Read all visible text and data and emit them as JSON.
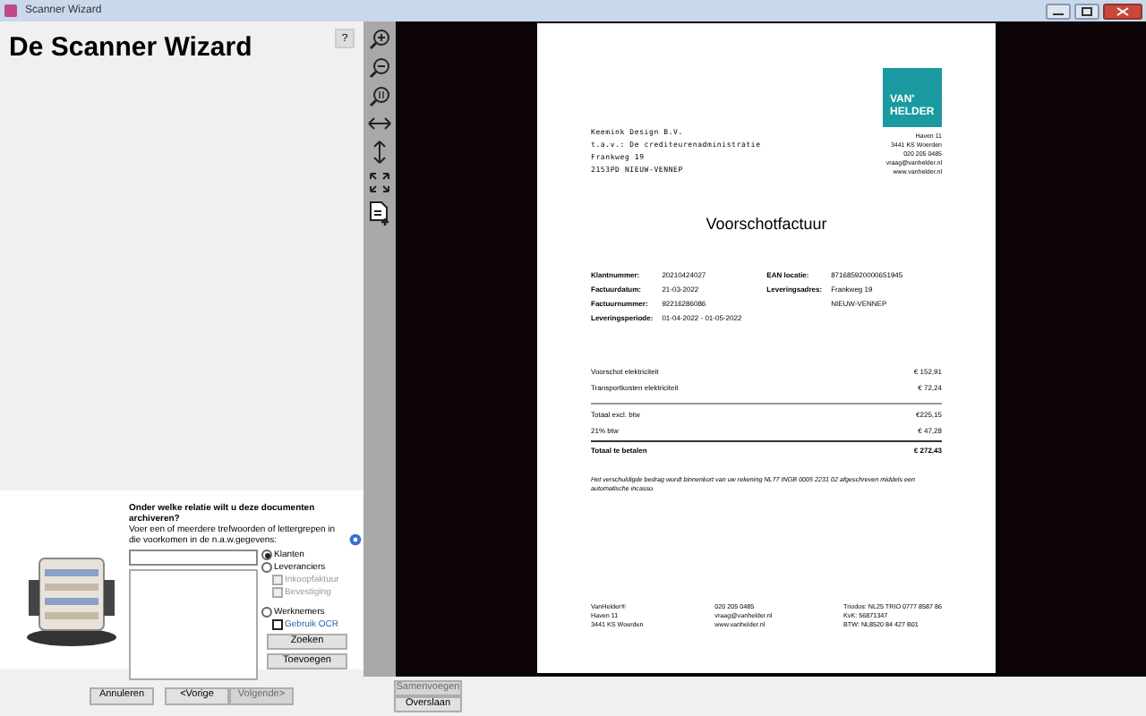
{
  "window": {
    "title": "Scanner Wizard"
  },
  "wizard": {
    "heading": "De Scanner Wizard",
    "help_button": "?"
  },
  "relation": {
    "question": "Onder welke relatie wilt u deze documenten archiveren?",
    "hint": "Voer een of meerdere trefwoorden of lettergrepen in die voorkomen in de n.a.w.gegevens:",
    "options": [
      {
        "kind": "radio",
        "label": "Klanten",
        "selected": true,
        "disabled": false
      },
      {
        "kind": "radio",
        "label": "Leveranciers",
        "selected": false,
        "disabled": false
      },
      {
        "kind": "checkbox",
        "label": "Inkoopfaktuur",
        "checked": false,
        "disabled": true
      },
      {
        "kind": "checkbox",
        "label": "Bevestiging",
        "checked": false,
        "disabled": true
      },
      {
        "kind": "radio",
        "label": "Werknemers",
        "selected": false,
        "disabled": false
      },
      {
        "kind": "checkbox",
        "label": "Gebruik OCR",
        "checked": false,
        "disabled": false
      }
    ],
    "buttons": [
      "Zoeken",
      "Toevoegen"
    ]
  },
  "nav_buttons": [
    {
      "label": "Annuleren",
      "disabled": false
    },
    {
      "label": "<Vorige",
      "disabled": false
    },
    {
      "label": "Volgende>",
      "disabled": true
    }
  ],
  "side_buttons": [
    {
      "label": "Samenvoegen",
      "disabled": true
    },
    {
      "label": "Overslaan",
      "disabled": false
    }
  ],
  "document": {
    "logo": [
      "VAN'",
      "HELDER"
    ],
    "sender": [
      "Haven 11",
      "3441 KS Woerden",
      "020 205 0485",
      "vraag@vanhelder.nl",
      "www.vanhelder.nl"
    ],
    "recipient": [
      "Keemink Design B.V.",
      "t.a.v.: De crediteurenadministratie",
      "Frankweg 19",
      "2153PD NIEUW-VENNEP"
    ],
    "title": "Voorschotfactuur",
    "fields_left": [
      {
        "label": "Klantnummer:",
        "value": "20210424027"
      },
      {
        "label": "Factuurdatum:",
        "value": "21-03-2022"
      },
      {
        "label": "Factuurnummer:",
        "value": "92216286086"
      },
      {
        "label": "Leveringsperiode:",
        "value": "01-04-2022 - 01-05-2022"
      }
    ],
    "fields_right": [
      {
        "label": "EAN locatie:",
        "value": "871685920000651945"
      },
      {
        "label": "Leveringsadres:",
        "value": "Frankweg 19"
      },
      {
        "value": "NIEUW-VENNEP"
      }
    ],
    "lines": [
      {
        "label": "Voorschot elektriciteit",
        "amount": "€ 152,91"
      },
      {
        "label": "Transportkosten elektriciteit",
        "amount": "€ 72,24"
      }
    ],
    "totals": [
      {
        "label": "Totaal excl. btw",
        "amount": "€225,15",
        "bold": false
      },
      {
        "label": "21% btw",
        "amount": "€ 47,28",
        "bold": false
      },
      {
        "label": "Totaal te betalen",
        "amount": "€ 272,43",
        "bold": true
      }
    ],
    "note": "Het verschuldigde bedrag wordt binnenkort van uw rekening NL77 INGB 0005 2231 02 afgeschreven middels een automatische incasso.",
    "footer": [
      [
        "VanHelder®",
        "Haven 11",
        "3441 KS Woerden"
      ],
      [
        "020 205 0485",
        "vraag@vanhelder.nl",
        "www.vanhelder.nl"
      ],
      [
        "Triodos: NL25 TRIO 0777 8587 86",
        "KvK: 56871347",
        "BTW: NL8520 84 427 B01"
      ]
    ]
  }
}
